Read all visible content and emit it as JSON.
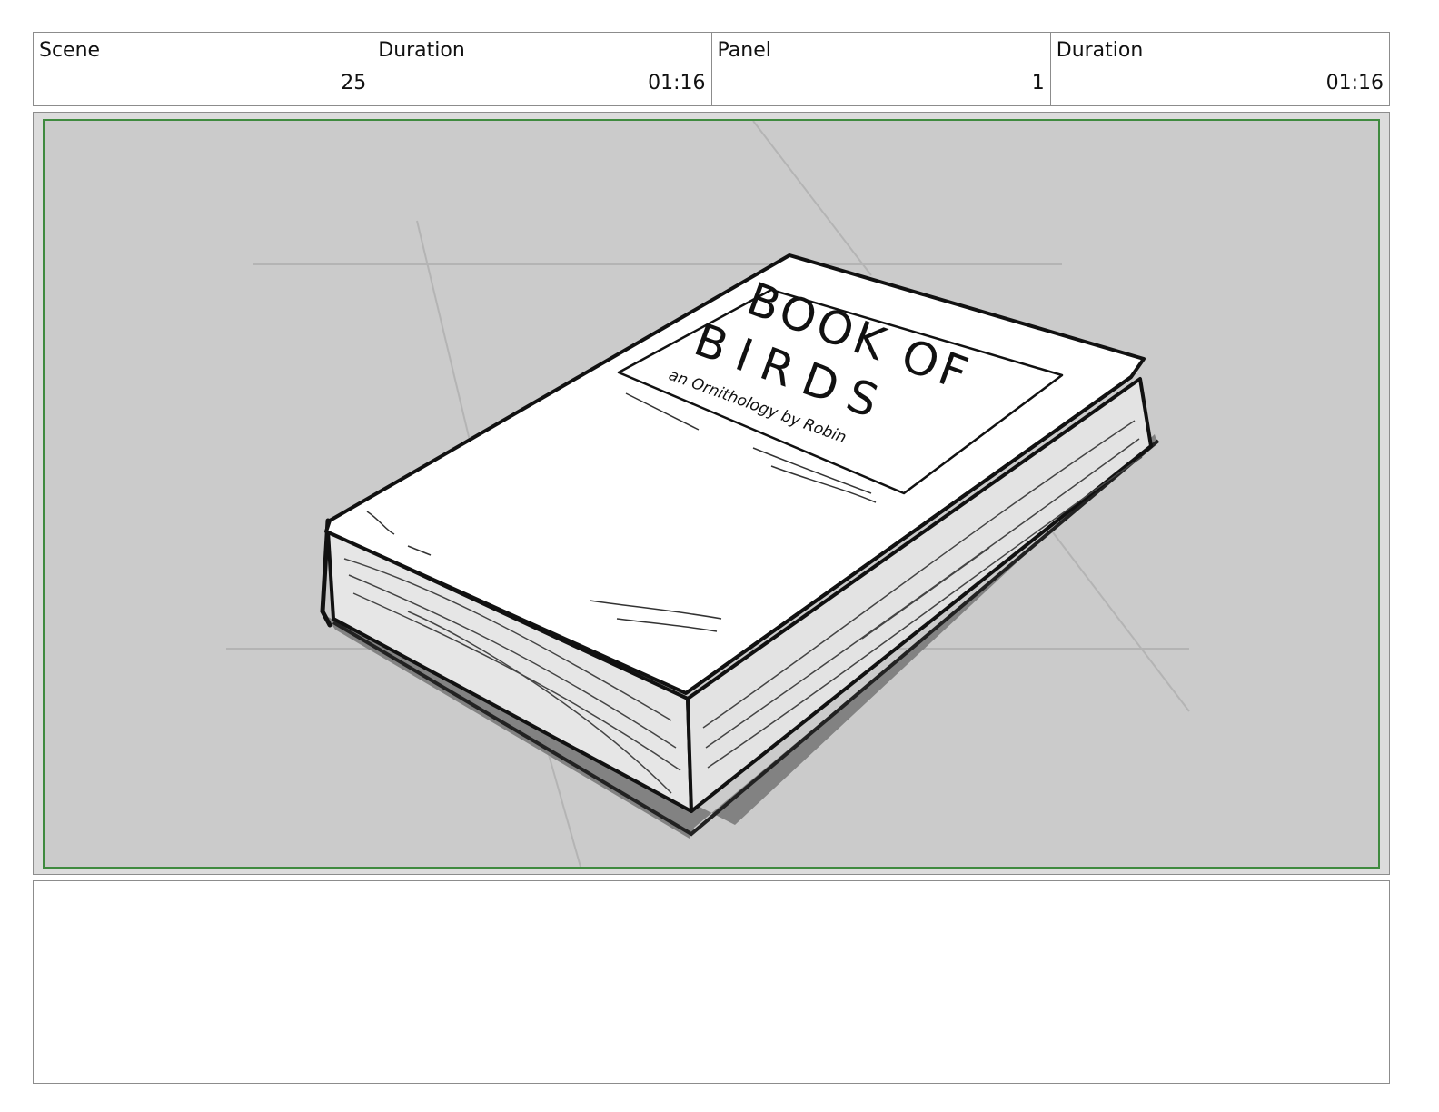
{
  "header": {
    "scene_label": "Scene",
    "scene_value": "25",
    "scene_duration_label": "Duration",
    "scene_duration_value": "01:16",
    "panel_label": "Panel",
    "panel_value": "1",
    "panel_duration_label": "Duration",
    "panel_duration_value": "01:16"
  },
  "panel": {
    "sketch_title_line1": "BOOK OF",
    "sketch_title_line2": "BIRDS",
    "sketch_subtitle": "an Ornithology by Robin",
    "frame_color": "#3f8a3f",
    "background_color": "#cbcbcb"
  },
  "notes": {
    "text": ""
  }
}
